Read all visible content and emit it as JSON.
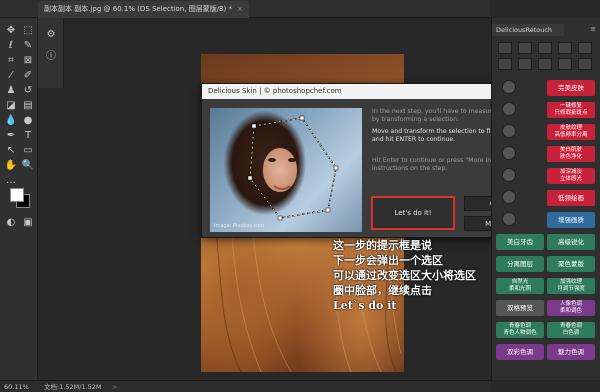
{
  "document_tab": {
    "title": "副本副本 副本.jpg @ 60.1% (DS Selection, 图层蒙版/8) *",
    "close": "×"
  },
  "toolbar": {
    "tools": [
      {
        "name": "move-tool-icon",
        "glyph": "✥"
      },
      {
        "name": "marquee-tool-icon",
        "glyph": "⬚"
      },
      {
        "name": "lasso-tool-icon",
        "glyph": "ℓ"
      },
      {
        "name": "quick-select-tool-icon",
        "glyph": "✎"
      },
      {
        "name": "crop-tool-icon",
        "glyph": "⌗"
      },
      {
        "name": "frame-tool-icon",
        "glyph": "⊠"
      },
      {
        "name": "eyedropper-tool-icon",
        "glyph": "⁄"
      },
      {
        "name": "brush-tool-icon",
        "glyph": "✐"
      },
      {
        "name": "stamp-tool-icon",
        "glyph": "♟"
      },
      {
        "name": "history-brush-tool-icon",
        "glyph": "↺"
      },
      {
        "name": "eraser-tool-icon",
        "glyph": "◪"
      },
      {
        "name": "gradient-tool-icon",
        "glyph": "▤"
      },
      {
        "name": "blur-tool-icon",
        "glyph": "💧"
      },
      {
        "name": "dodge-tool-icon",
        "glyph": "●"
      },
      {
        "name": "pen-tool-icon",
        "glyph": "✒"
      },
      {
        "name": "type-tool-icon",
        "glyph": "T"
      },
      {
        "name": "path-select-tool-icon",
        "glyph": "↖"
      },
      {
        "name": "shape-tool-icon",
        "glyph": "▭"
      },
      {
        "name": "hand-tool-icon",
        "glyph": "✋"
      },
      {
        "name": "zoom-tool-icon",
        "glyph": "🔍"
      },
      {
        "name": "edit-toolbar-icon",
        "glyph": "…"
      }
    ],
    "bottom": [
      {
        "name": "quick-mask-icon",
        "glyph": "◐"
      },
      {
        "name": "screen-mode-icon",
        "glyph": "▣"
      }
    ]
  },
  "minipanel": [
    {
      "name": "history-panel-icon",
      "glyph": "⚙"
    },
    {
      "name": "info-panel-icon",
      "glyph": "ⓘ"
    }
  ],
  "dialog": {
    "title": "Delicious Skin | © photoshopchef.com",
    "close": "×",
    "image_credit": "Image: Pixabay.com",
    "text1": "In the next step, you'll have to measure portrait size by transforming a selection.",
    "text2": "Move and transform the selection to fit subject's face and hit ENTER to continue.",
    "text3": "Hit Enter to continue or press \"More Info\" for more instructions on the step.",
    "lets_do_it": "Let's do it!",
    "cancel": "Cancel",
    "more_info": "More Info"
  },
  "annotation": {
    "lines": [
      "这一步的提示框是说",
      "下一步会弹出一个选区",
      "可以通过改变选区大小将选区",
      "圈中脸部，继续点击",
      "Let`s do it"
    ]
  },
  "right_panel": {
    "tab": "DeliciousRetouch",
    "menu": "≡",
    "buttons": [
      {
        "label": "完美皮肤",
        "color": "#c8213a",
        "two": false
      },
      {
        "label": "一键修复|只修瑕疵斑点",
        "color": "#c8213a",
        "two": true
      },
      {
        "label": "皮肤纹理|高低频率分离",
        "color": "#c8213a",
        "two": true
      },
      {
        "label": "美白肌肤|肤色净化",
        "color": "#c8213a",
        "two": true
      },
      {
        "label": "加深减淡|立体感光",
        "color": "#c8213a",
        "two": true
      },
      {
        "label": "低频绘画",
        "color": "#c8213a",
        "two": false
      },
      {
        "label": "增强画质",
        "color": "#2e6b9e",
        "two": false
      },
      {
        "label": "美白牙齿",
        "color": "#2e7b5d",
        "two": false
      },
      {
        "label": "高级锐化",
        "color": "#2e7b5d",
        "two": false
      },
      {
        "label": "分离图层",
        "color": "#2e7b5d",
        "two": false
      },
      {
        "label": "聚色蒙版",
        "color": "#2e7b5d",
        "two": false
      },
      {
        "label": "自然光|柔和光照",
        "color": "#2e7b5d",
        "two": true
      },
      {
        "label": "加强纹理|可调节强度",
        "color": "#2e7b5d",
        "two": true
      },
      {
        "label": "双格预览",
        "color": "#555555",
        "two": false
      },
      {
        "label": "人像色调|柔和调色",
        "color": "#7b3a8b",
        "two": true
      },
      {
        "label": "青春色调|青色人物调色",
        "color": "#2e7b5d",
        "two": true
      },
      {
        "label": "青春色调|白色调",
        "color": "#2e7b5d",
        "two": true
      },
      {
        "label": "双彩色调",
        "color": "#7b3a8b",
        "two": false
      },
      {
        "label": "魅力色调",
        "color": "#7b3a8b",
        "two": false
      }
    ]
  },
  "status": {
    "zoom": "60.11%",
    "doc": "文档:1.52M/1.52M",
    "arrow": ">"
  }
}
